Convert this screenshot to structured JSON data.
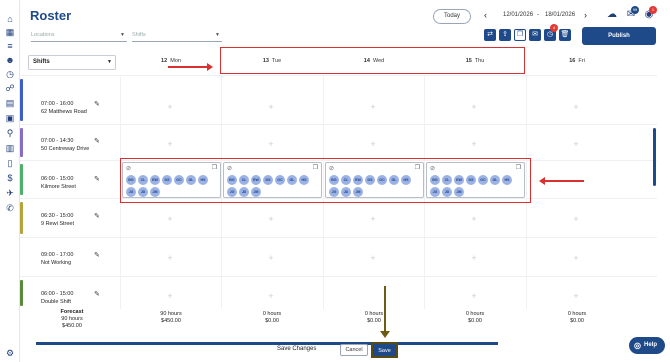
{
  "app": {
    "title": "Roster"
  },
  "header": {
    "today_label": "Today",
    "date_from": "12/01/2026",
    "date_sep": "-",
    "date_to": "18/01/2026",
    "mail_badge": "99",
    "notify_badge": "1"
  },
  "filters": {
    "locations_placeholder": "Locations",
    "shifts_placeholder": "Shifts",
    "publish_label": "Publish",
    "toolbar_badge": "4",
    "view_select": "Shifts"
  },
  "days": [
    {
      "num": "12",
      "name": "Mon"
    },
    {
      "num": "13",
      "name": "Tue"
    },
    {
      "num": "14",
      "name": "Wed"
    },
    {
      "num": "15",
      "name": "Thu"
    },
    {
      "num": "16",
      "name": "Fri"
    }
  ],
  "shifts": [
    {
      "time": "07:00 - 16:00",
      "location": "62 Matthews Road",
      "color": "#3b5fc4"
    },
    {
      "time": "07:00 - 14:30",
      "location": "50 Centreway Drive",
      "color": "#8b6cc4"
    },
    {
      "time": "06:00 - 15:00",
      "location": "Kilmore Street",
      "color": "#4caf6a"
    },
    {
      "time": "06:30 - 15:00",
      "location": "9 Rewi Street",
      "color": "#b6a43a"
    },
    {
      "time": "09:00 - 17:00",
      "location": "Not Working",
      "color": "#ffffff"
    },
    {
      "time": "06:00 - 15:00",
      "location": "Double Shift",
      "color": "#5c8a3c"
    }
  ],
  "staff_chips": [
    "BG",
    "CL",
    "EW",
    "DS",
    "GC",
    "GL",
    "HS",
    "JG",
    "JD",
    "JM"
  ],
  "forecast": {
    "label": "Forecast",
    "total_hours": "90 hours",
    "total_cost": "$450.00",
    "days": [
      {
        "hours": "90 hours",
        "cost": "$450.00"
      },
      {
        "hours": "0 hours",
        "cost": "$0.00"
      },
      {
        "hours": "0 hours",
        "cost": "$0.00"
      },
      {
        "hours": "0 hours",
        "cost": "$0.00"
      },
      {
        "hours": "0 hours",
        "cost": "$0.00"
      }
    ]
  },
  "footer": {
    "save_changes": "Save Changes",
    "cancel": "Cancel",
    "save": "Save",
    "help": "Help"
  },
  "colors": {
    "brand": "#1f4a8a",
    "annotation_red": "#d7322f",
    "annotation_olive": "#6f5a12"
  }
}
